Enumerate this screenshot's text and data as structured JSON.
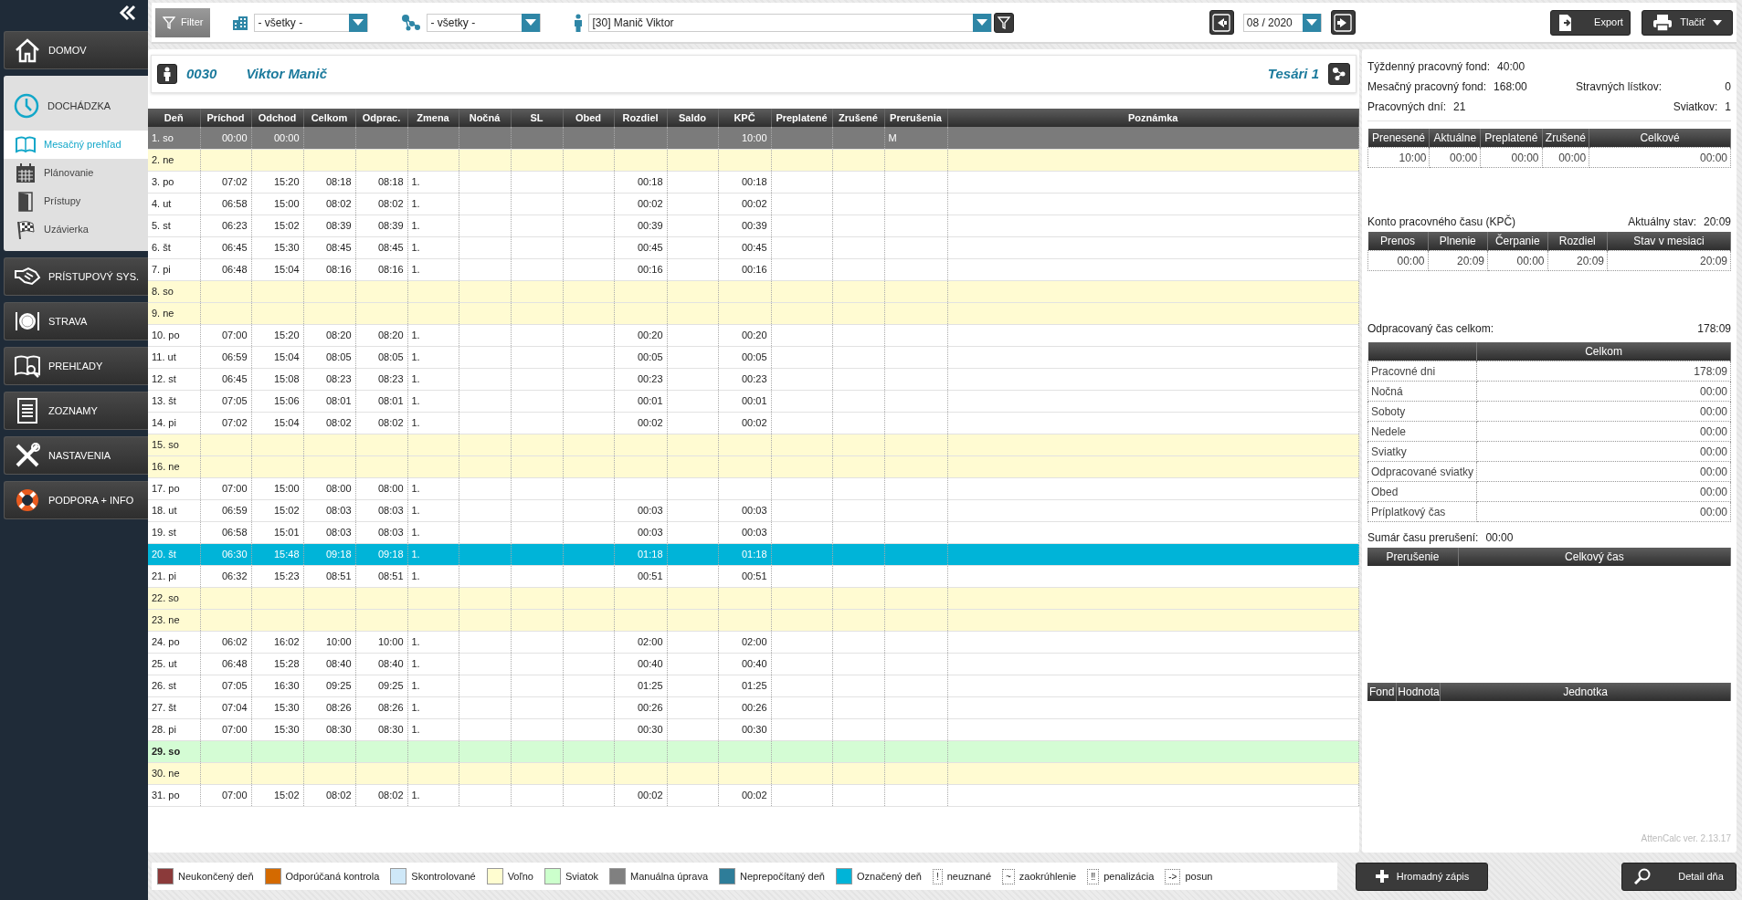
{
  "sidebar": {
    "items": [
      {
        "label": "DOMOV",
        "expanded": false
      },
      {
        "label": "DOCHÁDZKA",
        "expanded": true,
        "children": [
          {
            "label": "Mesačný prehľad",
            "selected": true
          },
          {
            "label": "Plánovanie",
            "selected": false
          },
          {
            "label": "Prístupy",
            "selected": false
          },
          {
            "label": "Uzávierka",
            "selected": false
          }
        ]
      },
      {
        "label": "PRÍSTUPOVÝ SYS.",
        "expanded": false
      },
      {
        "label": "STRAVA",
        "expanded": false
      },
      {
        "label": "PREHĽADY",
        "expanded": false
      },
      {
        "label": "ZOZNAMY",
        "expanded": false
      },
      {
        "label": "NASTAVENIA",
        "expanded": false
      },
      {
        "label": "PODPORA + INFO",
        "expanded": false
      }
    ]
  },
  "toolbar": {
    "filter_button": "Filter",
    "department": "- všetky -",
    "team": "- všetky -",
    "employee": "[30] Manič Viktor",
    "month": "08 / 2020",
    "export_button": "Export",
    "print_button": "Tlačiť"
  },
  "employee_header": {
    "number": "0030",
    "name": "Viktor Manič",
    "team": "Tesári 1"
  },
  "table": {
    "columns": [
      "Deň",
      "Príchod",
      "Odchod",
      "Celkom",
      "Odprac.",
      "Zmena",
      "Nočná",
      "SL",
      "Obed",
      "Rozdiel",
      "Saldo",
      "KPČ",
      "Preplatené",
      "Zrušené",
      "Prerušenia",
      "Poznámka"
    ],
    "rows": [
      {
        "day": "1. so",
        "kind": "manual",
        "selected": false,
        "arrival": "00:00",
        "departure": "00:00",
        "kpc": "10:00",
        "interruption": "M"
      },
      {
        "day": "2. ne",
        "kind": "weekend",
        "selected": false
      },
      {
        "day": "3. po",
        "kind": "workday",
        "selected": false,
        "arrival": "07:02",
        "departure": "15:20",
        "total": "08:18",
        "worked": "08:18",
        "shift": "1.",
        "difference": "00:18",
        "kpc": "00:18"
      },
      {
        "day": "4. ut",
        "kind": "workday",
        "selected": false,
        "arrival": "06:58",
        "departure": "15:00",
        "total": "08:02",
        "worked": "08:02",
        "shift": "1.",
        "difference": "00:02",
        "kpc": "00:02"
      },
      {
        "day": "5. st",
        "kind": "workday",
        "selected": false,
        "arrival": "06:23",
        "departure": "15:02",
        "total": "08:39",
        "worked": "08:39",
        "shift": "1.",
        "difference": "00:39",
        "kpc": "00:39"
      },
      {
        "day": "6. št",
        "kind": "workday",
        "selected": false,
        "arrival": "06:45",
        "departure": "15:30",
        "total": "08:45",
        "worked": "08:45",
        "shift": "1.",
        "difference": "00:45",
        "kpc": "00:45"
      },
      {
        "day": "7. pi",
        "kind": "workday",
        "selected": false,
        "arrival": "06:48",
        "departure": "15:04",
        "total": "08:16",
        "worked": "08:16",
        "shift": "1.",
        "difference": "00:16",
        "kpc": "00:16"
      },
      {
        "day": "8. so",
        "kind": "weekend",
        "selected": false
      },
      {
        "day": "9. ne",
        "kind": "weekend",
        "selected": false
      },
      {
        "day": "10. po",
        "kind": "workday",
        "selected": false,
        "arrival": "07:00",
        "departure": "15:20",
        "total": "08:20",
        "worked": "08:20",
        "shift": "1.",
        "difference": "00:20",
        "kpc": "00:20"
      },
      {
        "day": "11. ut",
        "kind": "workday",
        "selected": false,
        "arrival": "06:59",
        "departure": "15:04",
        "total": "08:05",
        "worked": "08:05",
        "shift": "1.",
        "difference": "00:05",
        "kpc": "00:05"
      },
      {
        "day": "12. st",
        "kind": "workday",
        "selected": false,
        "arrival": "06:45",
        "departure": "15:08",
        "total": "08:23",
        "worked": "08:23",
        "shift": "1.",
        "difference": "00:23",
        "kpc": "00:23"
      },
      {
        "day": "13. št",
        "kind": "workday",
        "selected": false,
        "arrival": "07:05",
        "departure": "15:06",
        "total": "08:01",
        "worked": "08:01",
        "shift": "1.",
        "difference": "00:01",
        "kpc": "00:01"
      },
      {
        "day": "14. pi",
        "kind": "workday",
        "selected": false,
        "arrival": "07:02",
        "departure": "15:04",
        "total": "08:02",
        "worked": "08:02",
        "shift": "1.",
        "difference": "00:02",
        "kpc": "00:02"
      },
      {
        "day": "15. so",
        "kind": "weekend",
        "selected": false
      },
      {
        "day": "16. ne",
        "kind": "weekend",
        "selected": false
      },
      {
        "day": "17. po",
        "kind": "workday",
        "selected": false,
        "arrival": "07:00",
        "departure": "15:00",
        "total": "08:00",
        "worked": "08:00",
        "shift": "1."
      },
      {
        "day": "18. ut",
        "kind": "workday",
        "selected": false,
        "arrival": "06:59",
        "departure": "15:02",
        "total": "08:03",
        "worked": "08:03",
        "shift": "1.",
        "difference": "00:03",
        "kpc": "00:03"
      },
      {
        "day": "19. st",
        "kind": "workday",
        "selected": false,
        "arrival": "06:58",
        "departure": "15:01",
        "total": "08:03",
        "worked": "08:03",
        "shift": "1.",
        "difference": "00:03",
        "kpc": "00:03"
      },
      {
        "day": "20. št",
        "kind": "workday",
        "selected": true,
        "arrival": "06:30",
        "departure": "15:48",
        "total": "09:18",
        "worked": "09:18",
        "shift": "1.",
        "difference": "01:18",
        "kpc": "01:18"
      },
      {
        "day": "21. pi",
        "kind": "workday",
        "selected": false,
        "arrival": "06:32",
        "departure": "15:23",
        "total": "08:51",
        "worked": "08:51",
        "shift": "1.",
        "difference": "00:51",
        "kpc": "00:51"
      },
      {
        "day": "22. so",
        "kind": "weekend",
        "selected": false
      },
      {
        "day": "23. ne",
        "kind": "weekend",
        "selected": false
      },
      {
        "day": "24. po",
        "kind": "workday",
        "selected": false,
        "arrival": "06:02",
        "departure": "16:02",
        "total": "10:00",
        "worked": "10:00",
        "shift": "1.",
        "difference": "02:00",
        "kpc": "02:00"
      },
      {
        "day": "25. ut",
        "kind": "workday",
        "selected": false,
        "arrival": "06:48",
        "departure": "15:28",
        "total": "08:40",
        "worked": "08:40",
        "shift": "1.",
        "difference": "00:40",
        "kpc": "00:40"
      },
      {
        "day": "26. st",
        "kind": "workday",
        "selected": false,
        "arrival": "07:05",
        "departure": "16:30",
        "total": "09:25",
        "worked": "09:25",
        "shift": "1.",
        "difference": "01:25",
        "kpc": "01:25"
      },
      {
        "day": "27. št",
        "kind": "workday",
        "selected": false,
        "arrival": "07:04",
        "departure": "15:30",
        "total": "08:26",
        "worked": "08:26",
        "shift": "1.",
        "difference": "00:26",
        "kpc": "00:26"
      },
      {
        "day": "28. pi",
        "kind": "workday",
        "selected": false,
        "arrival": "07:00",
        "departure": "15:30",
        "total": "08:30",
        "worked": "08:30",
        "shift": "1.",
        "difference": "00:30",
        "kpc": "00:30"
      },
      {
        "day": "29. so",
        "kind": "holiday",
        "selected": false
      },
      {
        "day": "30. ne",
        "kind": "weekend",
        "selected": false
      },
      {
        "day": "31. po",
        "kind": "workday",
        "selected": false,
        "arrival": "07:00",
        "departure": "15:02",
        "total": "08:02",
        "worked": "08:02",
        "shift": "1.",
        "difference": "00:02",
        "kpc": "00:02"
      }
    ]
  },
  "summary": {
    "weekly_fund": {
      "label": "Týždenný pracovný fond:",
      "value": "40:00"
    },
    "monthly_fund": {
      "label": "Mesačný pracovný fond:",
      "value": "168:00"
    },
    "meal_tickets": {
      "label": "Stravných lístkov:",
      "value": "0"
    },
    "working_days": {
      "label": "Pracovných dní:",
      "value": "21"
    },
    "holidays": {
      "label": "Sviatkov:",
      "value": "1"
    },
    "balance_table": {
      "columns": [
        "Prenesené",
        "Aktuálne",
        "Preplatené",
        "Zrušené",
        "Celkové"
      ],
      "rows": [
        [
          "10:00",
          "00:00",
          "00:00",
          "00:00",
          "00:00"
        ]
      ]
    },
    "kpc": {
      "title": "Konto pracovného času (KPČ)",
      "state_label": "Aktuálny stav:",
      "state_value": "20:09",
      "columns": [
        "Prenos",
        "Plnenie",
        "Čerpanie",
        "Rozdiel",
        "Stav v mesiaci"
      ],
      "rows": [
        [
          "00:00",
          "20:09",
          "00:00",
          "20:09",
          "20:09"
        ]
      ]
    },
    "worked": {
      "label": "Odpracovaný čas celkom:",
      "value": "178:09",
      "columns": [
        "",
        "Celkom"
      ],
      "rows": [
        [
          "Pracovné dni",
          "178:09"
        ],
        [
          "Nočná",
          "00:00"
        ],
        [
          "Soboty",
          "00:00"
        ],
        [
          "Nedele",
          "00:00"
        ],
        [
          "Sviatky",
          "00:00"
        ],
        [
          "Odpracované sviatky",
          "00:00"
        ],
        [
          "Obed",
          "00:00"
        ],
        [
          "Príplatkový čas",
          "00:00"
        ]
      ]
    },
    "interruptions": {
      "label": "Sumár času prerušení:",
      "value": "00:00",
      "columns": [
        "Prerušenie",
        "Celkový čas"
      ]
    },
    "funds": {
      "columns": [
        "Fond",
        "Hodnota",
        "Jednotka"
      ]
    },
    "version": "AttenCalc ver. 2.13.17"
  },
  "legend": [
    {
      "kind": "swatch",
      "label": "Neukončený deň",
      "color": "#8b3a3a"
    },
    {
      "kind": "swatch",
      "label": "Odporúčaná kontrola",
      "color": "#d46a00"
    },
    {
      "kind": "swatch",
      "label": "Skontrolované",
      "color": "#cfe8f8"
    },
    {
      "kind": "swatch",
      "label": "Voľno",
      "color": "#fffdd0"
    },
    {
      "kind": "swatch",
      "label": "Sviatok",
      "color": "#ccffcc"
    },
    {
      "kind": "swatch",
      "label": "Manuálna úprava",
      "color": "#808080"
    },
    {
      "kind": "swatch",
      "label": "Neprepočítaný deň",
      "color": "#2e7d99"
    },
    {
      "kind": "swatch",
      "label": "Označený deň",
      "color": "#00b4d8"
    },
    {
      "kind": "symbol",
      "symbol": "!",
      "label": "neuznané"
    },
    {
      "kind": "symbol",
      "symbol": "~",
      "label": "zaokrúhlenie"
    },
    {
      "kind": "symbol",
      "symbol": "‼",
      "label": "penalizácia"
    },
    {
      "kind": "symbol",
      "symbol": "->",
      "label": "posun"
    }
  ],
  "buttons": {
    "bulk_entry": "Hromadný zápis",
    "day_detail": "Detail dňa"
  }
}
